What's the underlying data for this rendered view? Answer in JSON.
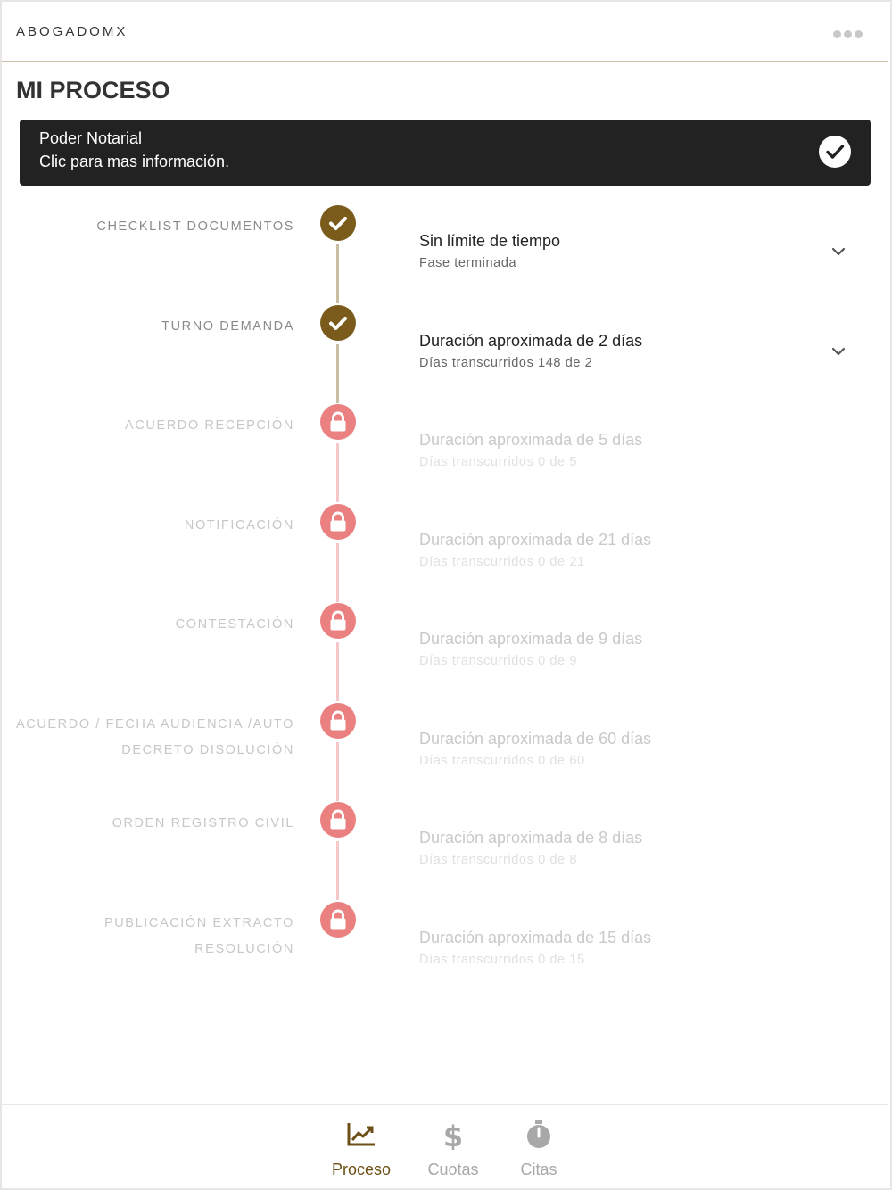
{
  "app": {
    "brand": "ABOGADOMX"
  },
  "page": {
    "title": "MI PROCESO"
  },
  "banner": {
    "line1": "Poder Notarial",
    "line2": "Clic para mas información."
  },
  "steps": [
    {
      "label": "CHECKLIST DOCUMENTOS",
      "title": "Sin límite de tiempo",
      "sub": "Fase terminada",
      "state": "done"
    },
    {
      "label": "TURNO DEMANDA",
      "title": "Duración aproximada de 2 días",
      "sub": "Días transcurridos 148 de 2",
      "state": "done"
    },
    {
      "label": "ACUERDO RECEPCIÓN",
      "title": "Duración aproximada de 5 días",
      "sub": "Días transcurridos 0 de 5",
      "state": "locked"
    },
    {
      "label": "NOTIFICACIÓN",
      "title": "Duración aproximada de 21 días",
      "sub": "Días transcurridos 0 de 21",
      "state": "locked"
    },
    {
      "label": "CONTESTACIÓN",
      "title": "Duración aproximada de 9 días",
      "sub": "Días transcurridos 0 de 9",
      "state": "locked"
    },
    {
      "label": "ACUERDO / FECHA AUDIENCIA /AUTO DECRETO DISOLUCIÓN",
      "title": "Duración aproximada de 60 días",
      "sub": "Días transcurridos 0 de 60",
      "state": "locked"
    },
    {
      "label": "ORDEN REGISTRO CIVIL",
      "title": "Duración aproximada de 8 días",
      "sub": "Días transcurridos 0 de 8",
      "state": "locked"
    },
    {
      "label": "PUBLICACIÓN EXTRACTO RESOLUCIÓN",
      "title": "Duración aproximada de 15 días",
      "sub": "Días transcurridos 0 de 15",
      "state": "locked"
    }
  ],
  "nav": {
    "tabs": [
      {
        "label": "Proceso",
        "icon": "chart-icon",
        "active": true
      },
      {
        "label": "Cuotas",
        "icon": "dollar-icon",
        "active": false
      },
      {
        "label": "Citas",
        "icon": "stopwatch-icon",
        "active": false
      }
    ]
  },
  "colors": {
    "done": "#7a5b1c",
    "locked": "#ea8080",
    "banner": "#222222",
    "accent": "#6b4f16"
  }
}
